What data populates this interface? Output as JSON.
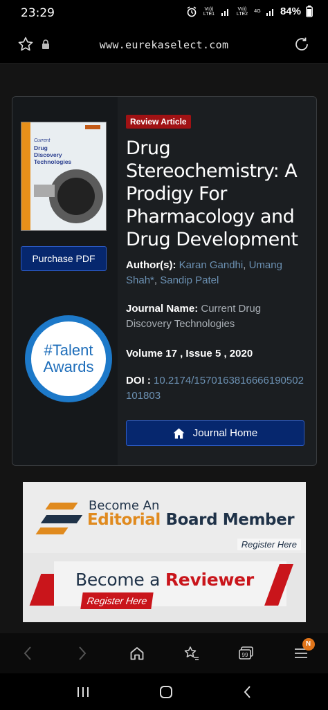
{
  "status": {
    "time": "23:29",
    "sim1": "Vo)) LTE1",
    "sim2": "Vo)) LTE2",
    "network": "4G",
    "battery": "84%"
  },
  "browser": {
    "url": "www.eurekaselect.com"
  },
  "article": {
    "badge": "Review Article",
    "title": "Drug Stereochemistry: A Prodigy For Pharmacology and Drug Development",
    "authors_label": "Author(s):",
    "authors": [
      {
        "name": "Karan Gandhi"
      },
      {
        "name": "Umang Shah*"
      },
      {
        "name": "Sandip Patel"
      }
    ],
    "journal_label": "Journal Name:",
    "journal": "Current Drug Discovery Technologies",
    "volume_line": "Volume 17 , Issue 5 , 2020",
    "doi_label": "DOI :",
    "doi": "10.2174/1570163816666190502101803",
    "purchase_label": "Purchase PDF",
    "journal_home_label": "Journal Home"
  },
  "cover": {
    "small": "Current",
    "line1": "Drug",
    "line2": "Discovery",
    "line3": "Technologies"
  },
  "award": {
    "line1": "#Talent",
    "line2": "Awards"
  },
  "banners": {
    "editorial": {
      "line1": "Become An",
      "line2a": "Editorial",
      "line2b": "Board Member",
      "register": "Register Here"
    },
    "reviewer": {
      "line1a": "Become a",
      "line1b": "Reviewer",
      "register": "Register Here"
    }
  },
  "toolbar": {
    "notification_badge": "N"
  },
  "colors": {
    "accent_button": "#06276e",
    "badge_red": "#a01214",
    "link": "#6c91b3",
    "award_blue": "#1d79c9"
  }
}
